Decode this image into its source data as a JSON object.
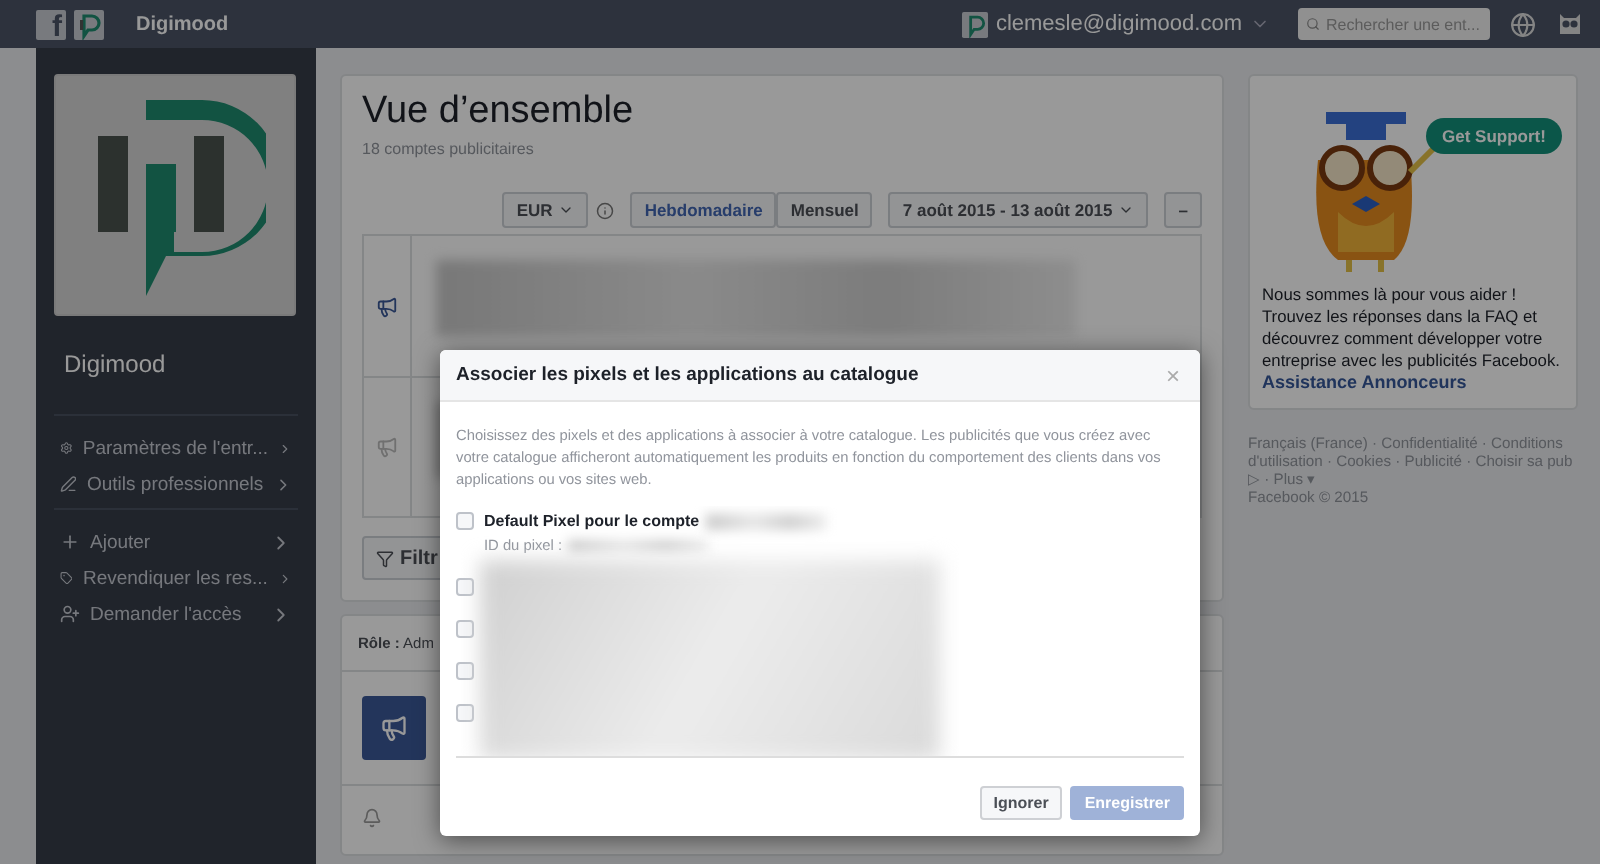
{
  "topbar": {
    "logo_letter": "f",
    "page_name": "Digimood",
    "account": "clemesle@digimood.com",
    "search": {
      "placeholder": "Rechercher une ent..."
    }
  },
  "sidebar": {
    "name": "Digimood",
    "groups": [
      [
        {
          "label": "Paramètres de l'entr..."
        },
        {
          "label": "Outils professionnels"
        }
      ],
      [
        {
          "label": "Ajouter"
        },
        {
          "label": "Revendiquer les res..."
        },
        {
          "label": "Demander l'accès"
        }
      ]
    ]
  },
  "overview": {
    "title": "Vue d’ensemble",
    "subtitle": "18 comptes publicitaires",
    "currency": "EUR",
    "periods": [
      {
        "label": "Hebdomadaire",
        "selected": true
      },
      {
        "label": "Mensuel",
        "selected": false
      }
    ],
    "date_range": "7 août 2015 - 13 août 2015",
    "collapse": "–",
    "rows": [
      {
        "active": true
      },
      {
        "active": false
      }
    ],
    "filter_button": "Filtr"
  },
  "role": {
    "label": "Rôle :",
    "value": "Adm"
  },
  "support": {
    "bubble": "Get Support!",
    "text": "Nous sommes là pour vous aider ! Trouvez les réponses dans la FAQ et découvrez comment développer votre entreprise avec les publicités Facebook.",
    "link": "Assistance Annonceurs"
  },
  "footer": {
    "text": "Français (France) · Confidentialité · Conditions d'utilisation · Cookies · Publicité · Choisir sa pub ▷ · Plus ▾",
    "copyright": "Facebook © 2015"
  },
  "dialog": {
    "title": "Associer les pixels et les applications au catalogue",
    "close": "×",
    "description": "Choisissez des pixels et des applications à associer à votre catalogue. Les publicités que vous créez avec votre catalogue afficheront automatiquement les produits en fonction du comportement des clients dans vos applications ou vos sites web.",
    "items": [
      {
        "label": "Default Pixel pour le compte",
        "detail": "ID du pixel :",
        "checked": false
      },
      {
        "checked": false
      },
      {
        "checked": false
      },
      {
        "checked": false
      },
      {
        "checked": false
      }
    ],
    "buttons": [
      {
        "label": "Ignorer",
        "kind": "secondary",
        "disabled": false
      },
      {
        "label": "Enregistrer",
        "kind": "primary",
        "disabled": true
      }
    ]
  }
}
